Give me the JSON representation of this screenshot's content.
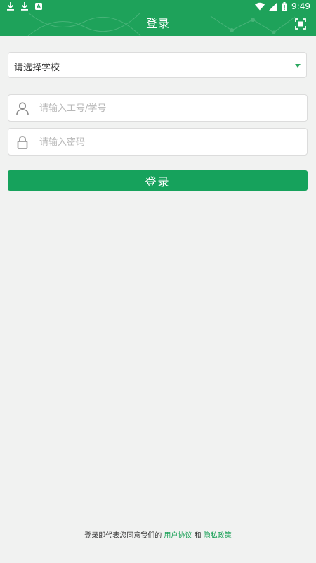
{
  "status_bar": {
    "time": "9:49"
  },
  "app_bar": {
    "title": "登录"
  },
  "form": {
    "school_select": {
      "label": "请选择学校"
    },
    "username": {
      "placeholder": "请输入工号/学号",
      "value": ""
    },
    "password": {
      "placeholder": "请输入密码",
      "value": ""
    },
    "login_button": "登录"
  },
  "footer": {
    "prefix": "登录即代表您同意我们的",
    "user_agreement": "用户协议",
    "conjunction": "和",
    "privacy_policy": "隐私政策"
  },
  "colors": {
    "primary": "#1ea25a",
    "button": "#16a25c",
    "background": "#f1f2f1"
  },
  "icons": [
    "download-icon",
    "download-icon",
    "notification-a-icon",
    "wifi-icon",
    "signal-icon",
    "battery-icon",
    "scan-icon",
    "user-icon",
    "lock-icon"
  ]
}
